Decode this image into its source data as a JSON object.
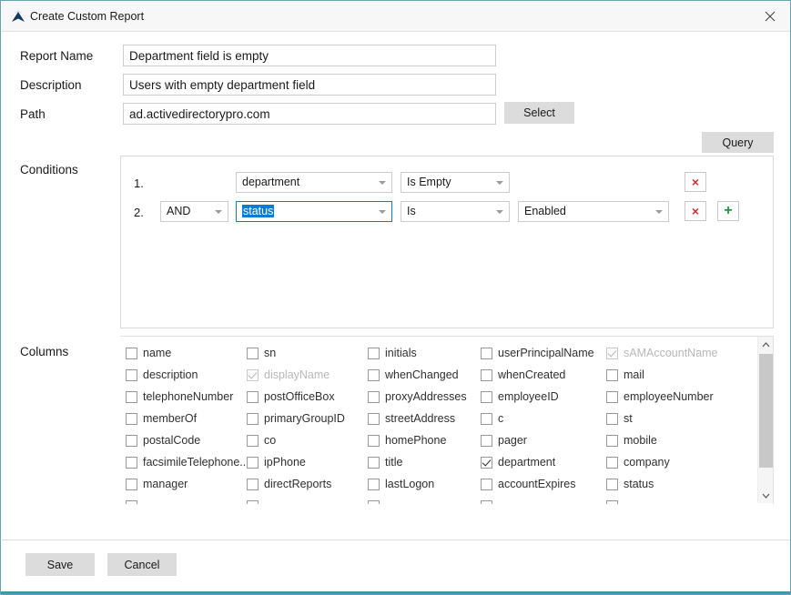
{
  "window": {
    "title": "Create Custom Report",
    "app_icon": "up-chevron-logo-icon",
    "close_icon": "close-icon",
    "border_color": "#6ba3b5"
  },
  "form": {
    "report_name": {
      "label": "Report Name",
      "value": "Department field is empty",
      "placeholder": ""
    },
    "description": {
      "label": "Description",
      "value": "Users with empty department field",
      "placeholder": ""
    },
    "path": {
      "label": "Path",
      "value": "ad.activedirectorypro.com",
      "placeholder": ""
    },
    "select_button": "Select",
    "query_button": "Query"
  },
  "conditions": {
    "label": "Conditions",
    "rows": [
      {
        "number": "1.",
        "operator": "",
        "attribute": "department",
        "comparison": "Is Empty",
        "value": "",
        "delete_label": "×",
        "has_value_field": false,
        "has_operator": false,
        "has_add": false,
        "attribute_focused": false
      },
      {
        "number": "2.",
        "operator": "AND",
        "attribute": "status",
        "comparison": "Is",
        "value": "Enabled",
        "delete_label": "×",
        "add_label": "+",
        "has_value_field": true,
        "has_operator": true,
        "has_add": true,
        "attribute_focused": true
      }
    ],
    "delete_icon": "delete-condition-icon",
    "add_icon": "add-condition-icon",
    "selection_color": "#0b7bd4"
  },
  "columns": {
    "label": "Columns",
    "items": [
      {
        "name": "name",
        "checked": false,
        "disabled": false,
        "col": 0,
        "row": 0
      },
      {
        "name": "sn",
        "checked": false,
        "disabled": false,
        "col": 1,
        "row": 0
      },
      {
        "name": "initials",
        "checked": false,
        "disabled": false,
        "col": 2,
        "row": 0
      },
      {
        "name": "userPrincipalName",
        "checked": false,
        "disabled": false,
        "col": 3,
        "row": 0
      },
      {
        "name": "sAMAccountName",
        "checked": true,
        "disabled": true,
        "col": 4,
        "row": 0
      },
      {
        "name": "description",
        "checked": false,
        "disabled": false,
        "col": 0,
        "row": 1
      },
      {
        "name": "displayName",
        "checked": true,
        "disabled": true,
        "col": 1,
        "row": 1
      },
      {
        "name": "whenChanged",
        "checked": false,
        "disabled": false,
        "col": 2,
        "row": 1
      },
      {
        "name": "whenCreated",
        "checked": false,
        "disabled": false,
        "col": 3,
        "row": 1
      },
      {
        "name": "mail",
        "checked": false,
        "disabled": false,
        "col": 4,
        "row": 1
      },
      {
        "name": "telephoneNumber",
        "checked": false,
        "disabled": false,
        "col": 0,
        "row": 2
      },
      {
        "name": "postOfficeBox",
        "checked": false,
        "disabled": false,
        "col": 1,
        "row": 2
      },
      {
        "name": "proxyAddresses",
        "checked": false,
        "disabled": false,
        "col": 2,
        "row": 2
      },
      {
        "name": "employeeID",
        "checked": false,
        "disabled": false,
        "col": 3,
        "row": 2
      },
      {
        "name": "employeeNumber",
        "checked": false,
        "disabled": false,
        "col": 4,
        "row": 2
      },
      {
        "name": "memberOf",
        "checked": false,
        "disabled": false,
        "col": 0,
        "row": 3
      },
      {
        "name": "primaryGroupID",
        "checked": false,
        "disabled": false,
        "col": 1,
        "row": 3
      },
      {
        "name": "streetAddress",
        "checked": false,
        "disabled": false,
        "col": 2,
        "row": 3
      },
      {
        "name": "c",
        "checked": false,
        "disabled": false,
        "col": 3,
        "row": 3
      },
      {
        "name": "st",
        "checked": false,
        "disabled": false,
        "col": 4,
        "row": 3
      },
      {
        "name": "postalCode",
        "checked": false,
        "disabled": false,
        "col": 0,
        "row": 4
      },
      {
        "name": "co",
        "checked": false,
        "disabled": false,
        "col": 1,
        "row": 4
      },
      {
        "name": "homePhone",
        "checked": false,
        "disabled": false,
        "col": 2,
        "row": 4
      },
      {
        "name": "pager",
        "checked": false,
        "disabled": false,
        "col": 3,
        "row": 4
      },
      {
        "name": "mobile",
        "checked": false,
        "disabled": false,
        "col": 4,
        "row": 4
      },
      {
        "name": "facsimileTelephone..",
        "checked": false,
        "disabled": false,
        "col": 0,
        "row": 5
      },
      {
        "name": "ipPhone",
        "checked": false,
        "disabled": false,
        "col": 1,
        "row": 5
      },
      {
        "name": "title",
        "checked": false,
        "disabled": false,
        "col": 2,
        "row": 5
      },
      {
        "name": "department",
        "checked": true,
        "disabled": false,
        "col": 3,
        "row": 5
      },
      {
        "name": "company",
        "checked": false,
        "disabled": false,
        "col": 4,
        "row": 5
      },
      {
        "name": "manager",
        "checked": false,
        "disabled": false,
        "col": 0,
        "row": 6
      },
      {
        "name": "directReports",
        "checked": false,
        "disabled": false,
        "col": 1,
        "row": 6
      },
      {
        "name": "lastLogon",
        "checked": false,
        "disabled": false,
        "col": 2,
        "row": 6
      },
      {
        "name": "accountExpires",
        "checked": false,
        "disabled": false,
        "col": 3,
        "row": 6
      },
      {
        "name": "status",
        "checked": false,
        "disabled": false,
        "col": 4,
        "row": 6
      },
      {
        "name": "",
        "checked": false,
        "disabled": false,
        "col": 0,
        "row": 7
      },
      {
        "name": "",
        "checked": false,
        "disabled": false,
        "col": 1,
        "row": 7
      },
      {
        "name": "",
        "checked": false,
        "disabled": false,
        "col": 2,
        "row": 7
      },
      {
        "name": "",
        "checked": false,
        "disabled": false,
        "col": 3,
        "row": 7
      },
      {
        "name": "",
        "checked": false,
        "disabled": false,
        "col": 4,
        "row": 7
      }
    ],
    "scrollbar": {
      "up_icon": "chevron-up-icon",
      "down_icon": "chevron-down-icon"
    }
  },
  "footer": {
    "save_label": "Save",
    "cancel_label": "Cancel"
  }
}
